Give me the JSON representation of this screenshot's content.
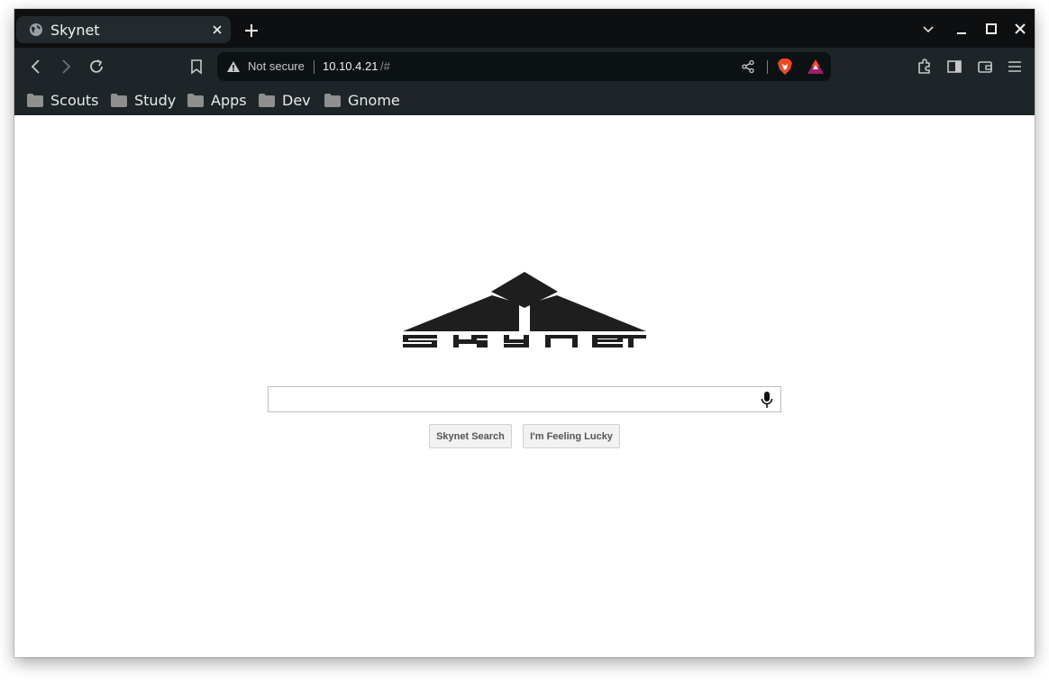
{
  "tab": {
    "title": "Skynet",
    "favicon": "globe-icon"
  },
  "address_bar": {
    "security_label": "Not secure",
    "url_host": "10.10.4.21",
    "url_path": "/#"
  },
  "bookmarks": [
    {
      "label": "Scouts"
    },
    {
      "label": "Study"
    },
    {
      "label": "Apps"
    },
    {
      "label": "Dev"
    },
    {
      "label": "Gnome"
    }
  ],
  "page": {
    "logo_text": "skynet",
    "search_placeholder": "",
    "search_button_label": "Skynet Search",
    "lucky_button_label": "I'm Feeling Lucky"
  },
  "colors": {
    "tabstrip_bg": "#0e0f10",
    "toolbar_bg": "#1d2528",
    "active_tab_bg": "#232a2e",
    "logo": "#1e1e1e"
  }
}
